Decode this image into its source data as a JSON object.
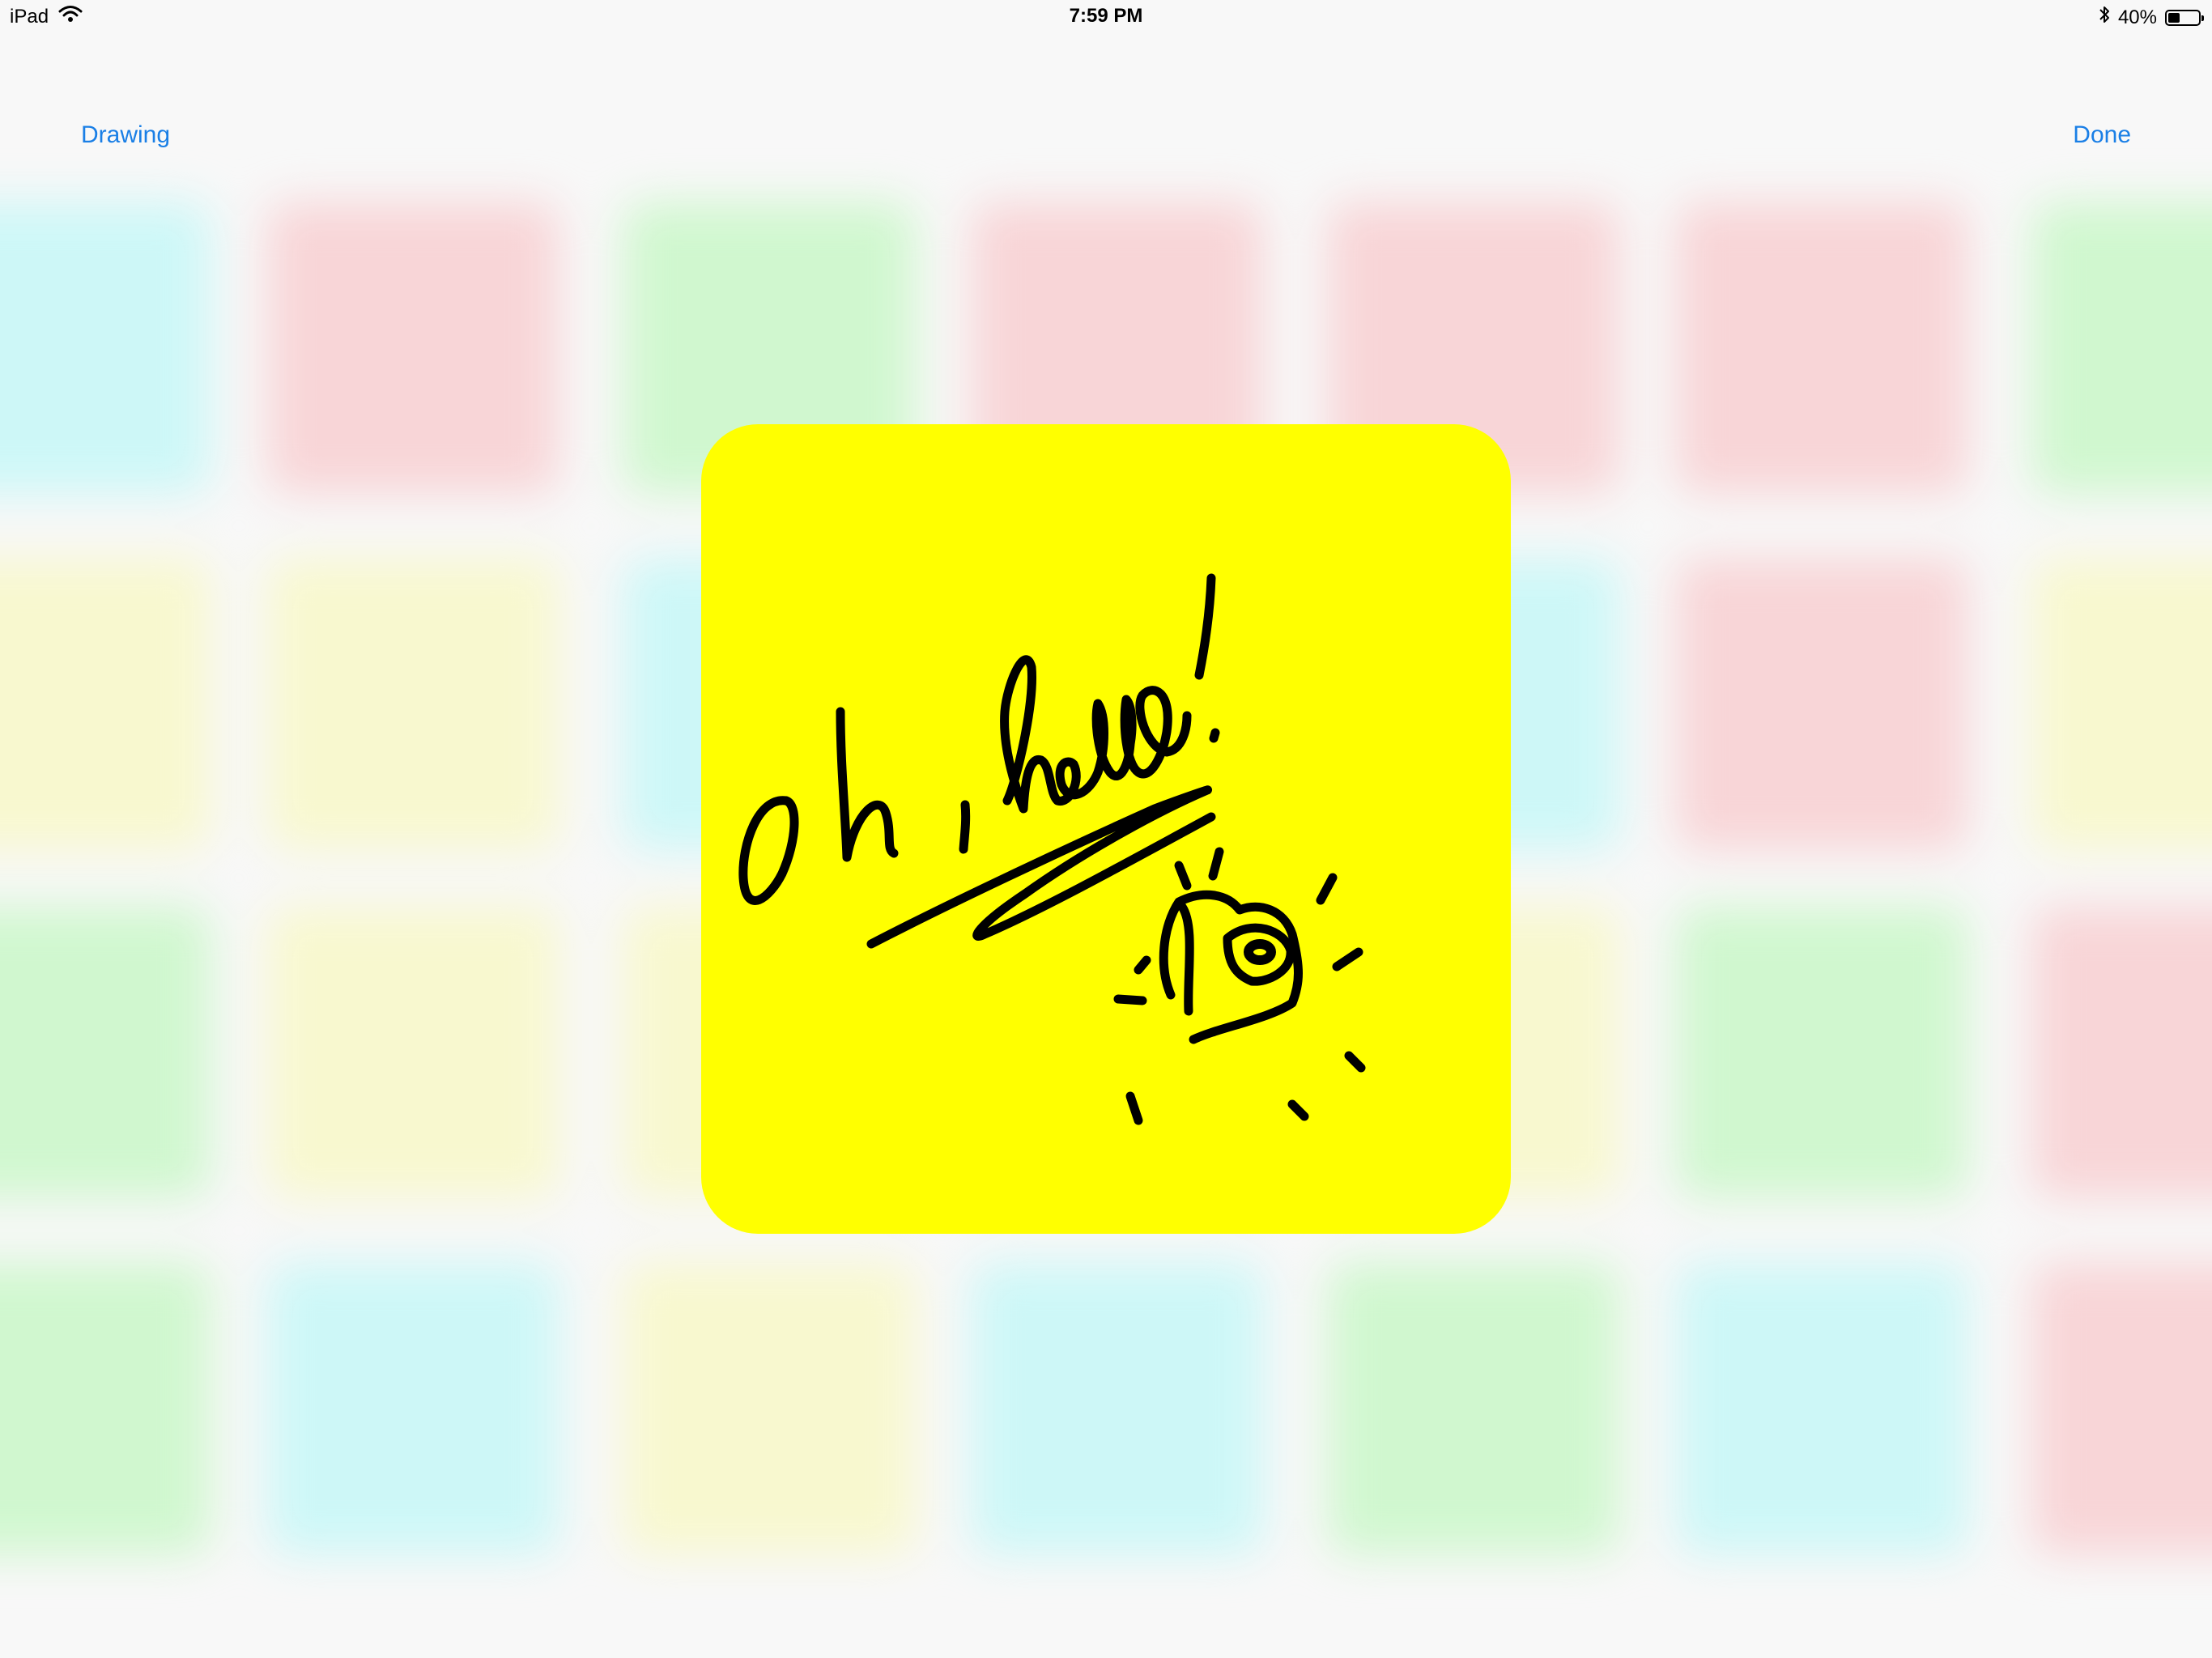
{
  "status_bar": {
    "device": "iPad",
    "time": "7:59 PM",
    "battery_percent": "40%",
    "battery_level": 0.4,
    "icons": [
      "wifi-icon",
      "bluetooth-icon",
      "battery-icon"
    ]
  },
  "nav_bar": {
    "left_label": "Drawing",
    "right_label": "Done"
  },
  "colors": {
    "accent": "#1a7fe6",
    "note": "#ffff00",
    "tile_cyan": "#cdf7f7",
    "tile_red": "#f8d5d7",
    "tile_green": "#d0f7cf",
    "tile_yellow": "#f8f8cf"
  },
  "tiles": [
    [
      "cyan",
      "red",
      "green",
      "red",
      "red",
      "red",
      "green"
    ],
    [
      "yellow",
      "yellow",
      "cyan",
      "yellow",
      "cyan",
      "red",
      "yellow"
    ],
    [
      "green",
      "yellow",
      "yellow",
      "yellow",
      "yellow",
      "green",
      "red"
    ],
    [
      "green",
      "cyan",
      "yellow",
      "cyan",
      "green",
      "cyan",
      "red"
    ]
  ],
  "note": {
    "handwriting": "oh, hello!"
  }
}
